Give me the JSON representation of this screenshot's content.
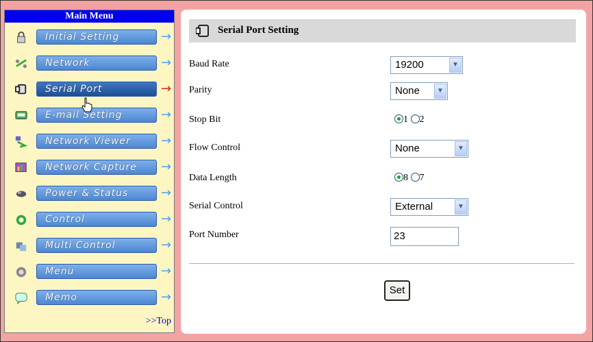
{
  "sidebar": {
    "title": "Main Menu",
    "items": [
      {
        "label": "Initial Setting",
        "icon": "lock-icon",
        "active": false
      },
      {
        "label": "Network",
        "icon": "network-icon",
        "active": false
      },
      {
        "label": "Serial Port",
        "icon": "serial-port-icon",
        "active": true
      },
      {
        "label": "E-mail Setting",
        "icon": "email-icon",
        "active": false
      },
      {
        "label": "Network Viewer",
        "icon": "network-viewer-icon",
        "active": false
      },
      {
        "label": "Network Capture",
        "icon": "network-capture-icon",
        "active": false
      },
      {
        "label": "Power & Status",
        "icon": "power-status-icon",
        "active": false
      },
      {
        "label": "Control",
        "icon": "control-icon",
        "active": false
      },
      {
        "label": "Multi Control",
        "icon": "multi-control-icon",
        "active": false
      },
      {
        "label": "Menu",
        "icon": "menu-icon",
        "active": false
      },
      {
        "label": "Memo",
        "icon": "memo-icon",
        "active": false
      }
    ],
    "top_link": ">>Top",
    "arrow": "→"
  },
  "panel": {
    "title": "Serial Port Setting",
    "baud_rate": {
      "label": "Baud Rate",
      "value": "19200"
    },
    "parity": {
      "label": "Parity",
      "value": "None"
    },
    "stop_bit": {
      "label": "Stop Bit",
      "option1": "1",
      "option2": "2",
      "selected": "1"
    },
    "flow_control": {
      "label": "Flow Control",
      "value": "None"
    },
    "data_length": {
      "label": "Data Length",
      "option1": "8",
      "option2": "7",
      "selected": "8"
    },
    "serial_control": {
      "label": "Serial Control",
      "value": "External"
    },
    "port_number": {
      "label": "Port Number",
      "value": "23"
    },
    "set_button": "Set"
  },
  "colors": {
    "background": "#f4a3a3",
    "sidebar": "#fdf6c2",
    "menu_title": "#0000ee",
    "button": "#4d86d2"
  }
}
